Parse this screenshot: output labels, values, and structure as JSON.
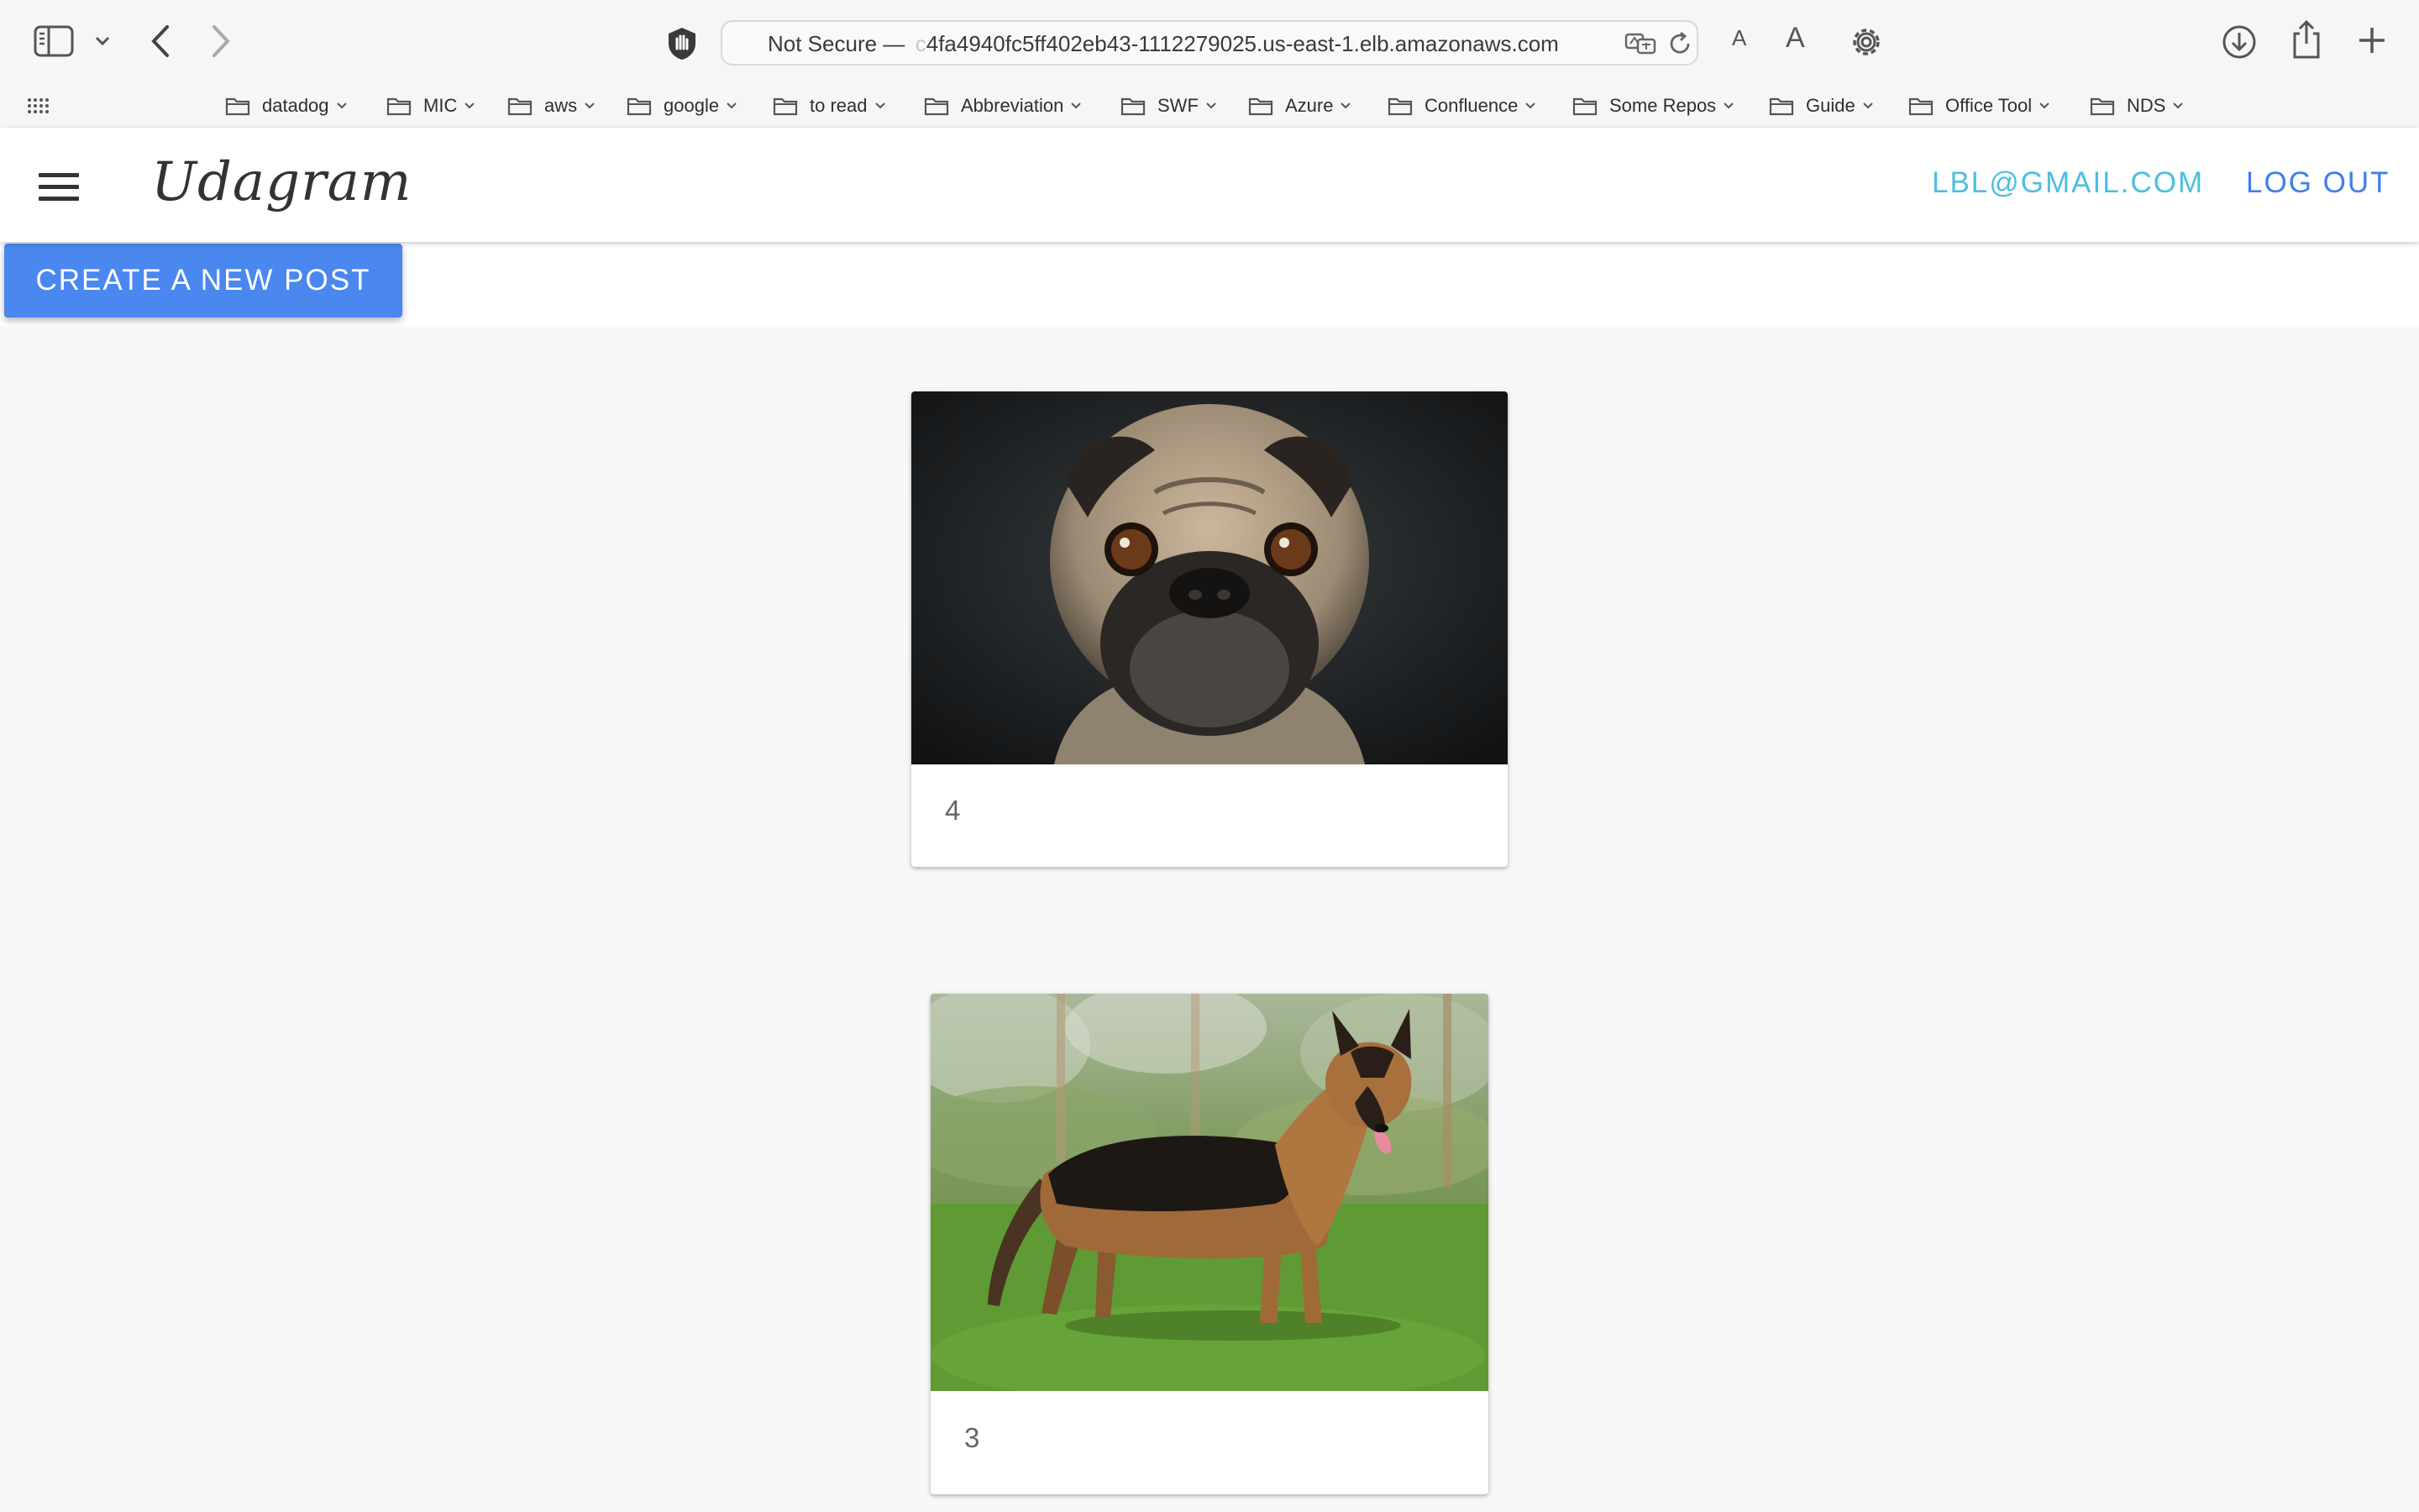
{
  "browser": {
    "url_prefix": "Not Secure —",
    "url_faded": " c",
    "url_host": "4fa4940fc5ff402eb43-1112279025.us-east-1.elb.amazonaws.com",
    "text_smaller": "A",
    "text_larger": "A",
    "bookmarks": [
      {
        "label": "datadog"
      },
      {
        "label": "MIC"
      },
      {
        "label": "aws"
      },
      {
        "label": "google"
      },
      {
        "label": "to read"
      },
      {
        "label": "Abbreviation"
      },
      {
        "label": "SWF"
      },
      {
        "label": "Azure"
      },
      {
        "label": "Confluence"
      },
      {
        "label": "Some Repos"
      },
      {
        "label": "Guide"
      },
      {
        "label": "Office Tool"
      },
      {
        "label": "NDS"
      }
    ]
  },
  "app": {
    "logo": "Udagram",
    "user_email": "LBL@GMAIL.COM",
    "logout_label": "LOG OUT",
    "create_post_label": "CREATE A NEW POST",
    "accent_color": "#4a87ee"
  },
  "feed": {
    "posts": [
      {
        "caption": "4",
        "image": "pug-photo"
      },
      {
        "caption": "3",
        "image": "german-shepherd-photo"
      }
    ]
  }
}
